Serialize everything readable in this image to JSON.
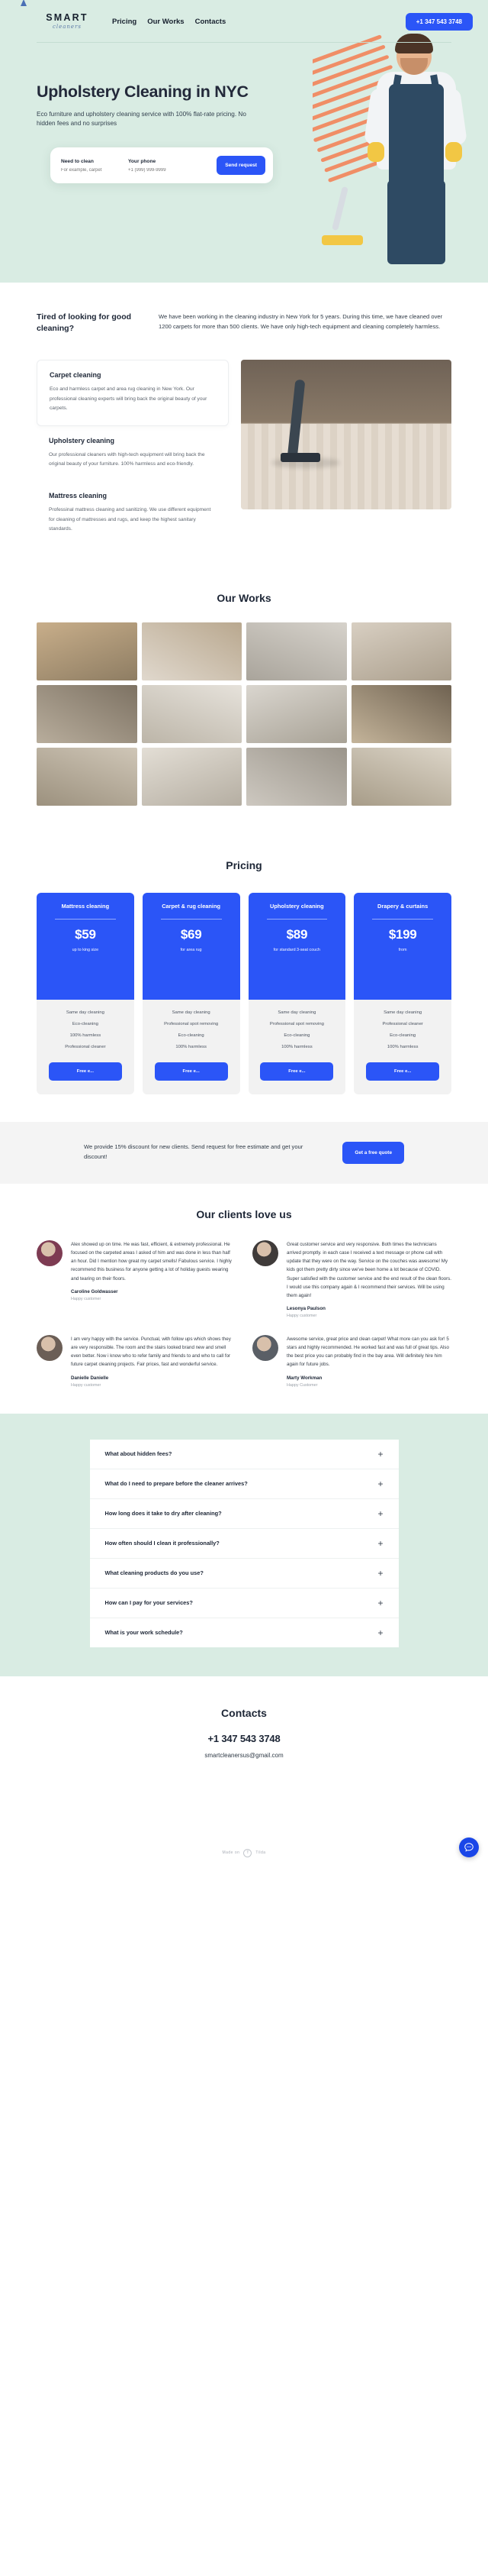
{
  "header": {
    "logo_main": "SMART",
    "logo_sub": "cleaners",
    "nav": [
      {
        "label": "Pricing"
      },
      {
        "label": "Our Works"
      },
      {
        "label": "Contacts"
      }
    ],
    "phone_button": "+1 347 543 3748"
  },
  "hero": {
    "title": "Upholstery Cleaning in NYC",
    "subtitle": "Eco furniture and upholstery cleaning service with 100% flat-rate pricing. No hidden fees and no surprises",
    "form": {
      "field1_label": "Need to clean",
      "field1_placeholder": "For example, carpet",
      "field2_label": "Your phone",
      "field2_placeholder": "+1 (999) 999-9999",
      "submit_label": "Send request"
    }
  },
  "about": {
    "heading": "Tired of looking for good cleaning?",
    "paragraph": "We have been working in the cleaning industry in New York for 5 years. During this time, we have cleaned over 1200 carpets for more than 500 clients. We have only high-tech equipment and cleaning completely harmless."
  },
  "services": [
    {
      "title": "Carpet cleaning",
      "text": "Eco and harmless carpet and area rug cleaning in New York. Our professional cleaning experts will bring back the original beauty of your carpets."
    },
    {
      "title": "Upholstery cleaning",
      "text": "Our professional cleaners with high-tech equipment will bring back the original beauty of your furniture. 100% harmless and eco-friendly."
    },
    {
      "title": "Mattress cleaning",
      "text": "Professinal mattress cleaning and sanitizing. We use different equipment for cleaning of mattresses and rugs, and keep the highest sanitary standards."
    }
  ],
  "works": {
    "title": "Our Works",
    "cells": [
      {
        "name": "work-1",
        "color1": "#c8ae8a",
        "color2": "#8e7d63"
      },
      {
        "name": "work-2",
        "color1": "#e0d8cd",
        "color2": "#b9a88f"
      },
      {
        "name": "work-3",
        "color1": "#d6d2cb",
        "color2": "#a9a49b"
      },
      {
        "name": "work-4",
        "color1": "#d8cfc2",
        "color2": "#ab9f8d"
      },
      {
        "name": "work-5",
        "color1": "#b8ad9c",
        "color2": "#7d7263"
      },
      {
        "name": "work-6",
        "color1": "#e6e2db",
        "color2": "#bcb5a8"
      },
      {
        "name": "work-7",
        "color1": "#dad6cf",
        "color2": "#a8a296"
      },
      {
        "name": "work-8",
        "color1": "#c4b49a",
        "color2": "#6f6251"
      },
      {
        "name": "work-9",
        "color1": "#cfc6b7",
        "color2": "#9c917e"
      },
      {
        "name": "work-10",
        "color1": "#e3ded5",
        "color2": "#b5aea2"
      },
      {
        "name": "work-11",
        "color1": "#cdc8c0",
        "color2": "#9b958b"
      },
      {
        "name": "work-12",
        "color1": "#dcd5c8",
        "color2": "#a79c88"
      }
    ]
  },
  "pricing": {
    "title": "Pricing",
    "cards": [
      {
        "name": "Mattress cleaning",
        "price": "$59",
        "note": "up to king size",
        "features": [
          "Same day cleaning",
          "Eco-cleaning",
          "100% harmless",
          "Professional cleaner"
        ],
        "button": "Free e..."
      },
      {
        "name": "Carpet & rug cleaning",
        "price": "$69",
        "note": "for area rug",
        "features": [
          "Same day cleaning",
          "Professional spot removing",
          "Eco-cleaning",
          "100% harmless"
        ],
        "button": "Free e..."
      },
      {
        "name": "Upholstery cleaning",
        "price": "$89",
        "note": "for standard 3-seat couch",
        "features": [
          "Same day cleaning",
          "Professional spot removing",
          "Eco-cleaning",
          "100% harmless"
        ],
        "button": "Free e..."
      },
      {
        "name": "Drapery & curtains",
        "price": "$199",
        "note": "from",
        "features": [
          "Same day cleaning",
          "Professional cleaner",
          "Eco-cleaning",
          "100% harmless"
        ],
        "button": "Free e..."
      }
    ]
  },
  "discount": {
    "text": "We provide 15% discount for new clients. Send request for free estimate and get your discount!",
    "button": "Get a free quote"
  },
  "reviews": {
    "title": "Our clients love us",
    "items": [
      {
        "text": "Alex showed up on time. He was fast, efficient, & extremely professional. He focused on the carpeted areas I asked of him and was done in less than half an hour. Did I mention how great my carpet smells! Fabulous service. I highly recommend this business for anyone getting a lot of holiday guests wearing and tearing on their floors.",
        "name": "Caroline Goldwasser",
        "role": "Happy customer",
        "avatar_color": "#7d3b52"
      },
      {
        "text": "Great customer service and very responsive. Both times the technicians arrived promptly. in each case I received a text message or phone call with update that they were on the way. Service on the couches was awesome! My kids got them pretty dirty since we've been home a lot because of COVID. Super satisfied with the customer service and the end result of the clean floors. I would use this company again & I recommend their services. Will be using them again!",
        "name": "Lesonya Paulson",
        "role": "Happy customer",
        "avatar_color": "#3f3b3a"
      },
      {
        "text": "I am very happy with the service. Punctual, with follow ups which shows they are very responsible. The room and the stairs looked brand new and smell even better. Now i know who to refer family and friends to and who to call for future carpet cleaning projects. Fair prices, fast and wonderful service.",
        "name": "Danielle Danielle",
        "role": "Happy customer",
        "avatar_color": "#6b5e56"
      },
      {
        "text": "Awesome service, great price and clean carpet! What more can you ask for! 5 stars and highly recommended. He worked fast and was full of great tips. Also the best price you can probably find in the bay area. Will definitely hire him again for future jobs.",
        "name": "Marty Workman",
        "role": "Happy Customer",
        "avatar_color": "#5a5f66"
      }
    ]
  },
  "faq": {
    "items": [
      {
        "question": "What about hidden fees?"
      },
      {
        "question": "What do I need to prepare before the cleaner arrives?"
      },
      {
        "question": "How long does it take to dry after cleaning?"
      },
      {
        "question": "How often should I clean it professionally?"
      },
      {
        "question": "What cleaning products do you use?"
      },
      {
        "question": "How can I pay for your services?"
      },
      {
        "question": "What is your work schedule?"
      }
    ],
    "expand_icon": "+"
  },
  "contacts": {
    "title": "Contacts",
    "phone": "+1 347 543 3748",
    "email": "smartcleanersus@gmail.com"
  },
  "footer": {
    "made_on": "Made on",
    "platform": "Tilda",
    "tilda_mark": "T"
  },
  "colors": {
    "brand_blue": "#2b55f7",
    "mint": "#d9ece3",
    "ink": "#1d2636"
  }
}
